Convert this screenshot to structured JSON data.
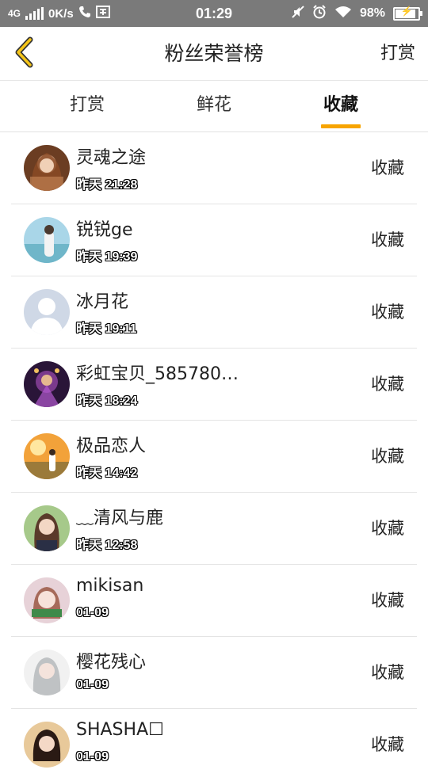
{
  "status_bar": {
    "network": "4G",
    "speed": "0K/s",
    "time": "01:29",
    "battery": "98%",
    "battery_level": 0.98
  },
  "header": {
    "title": "粉丝荣誉榜",
    "action": "打赏"
  },
  "tabs": [
    {
      "label": "打赏",
      "active": false
    },
    {
      "label": "鲜花",
      "active": false
    },
    {
      "label": "收藏",
      "active": true
    }
  ],
  "accent_color": "#f7a400",
  "fans": [
    {
      "name": "灵魂之途",
      "time": "昨天 21:28",
      "action": "收藏"
    },
    {
      "name": "锐锐ge",
      "time": "昨天 19:39",
      "action": "收藏"
    },
    {
      "name": "冰月花",
      "time": "昨天 19:11",
      "action": "收藏"
    },
    {
      "name": "彩虹宝贝_585780…",
      "time": "昨天 18:24",
      "action": "收藏"
    },
    {
      "name": "极品恋人",
      "time": "昨天 14:42",
      "action": "收藏"
    },
    {
      "name": "﹏清风与鹿",
      "time": "昨天 12:58",
      "action": "收藏"
    },
    {
      "name": "mikisan",
      "time": "01-09",
      "action": "收藏"
    },
    {
      "name": "樱花残心",
      "time": "01-09",
      "action": "收藏"
    },
    {
      "name": "SHASHA☐",
      "time": "01-09",
      "action": "收藏"
    }
  ]
}
